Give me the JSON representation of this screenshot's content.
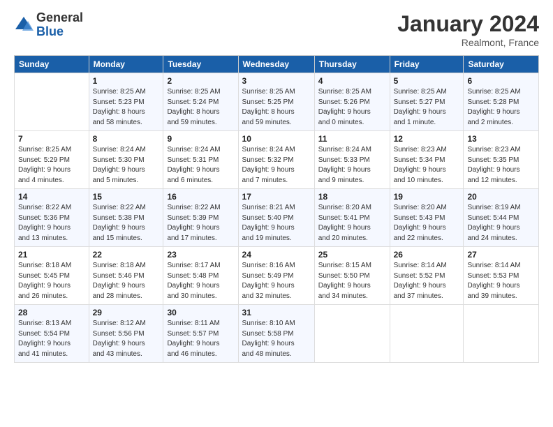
{
  "logo": {
    "general": "General",
    "blue": "Blue"
  },
  "title": "January 2024",
  "location": "Realmont, France",
  "days_header": [
    "Sunday",
    "Monday",
    "Tuesday",
    "Wednesday",
    "Thursday",
    "Friday",
    "Saturday"
  ],
  "weeks": [
    [
      {
        "num": "",
        "info": ""
      },
      {
        "num": "1",
        "info": "Sunrise: 8:25 AM\nSunset: 5:23 PM\nDaylight: 8 hours\nand 58 minutes."
      },
      {
        "num": "2",
        "info": "Sunrise: 8:25 AM\nSunset: 5:24 PM\nDaylight: 8 hours\nand 59 minutes."
      },
      {
        "num": "3",
        "info": "Sunrise: 8:25 AM\nSunset: 5:25 PM\nDaylight: 8 hours\nand 59 minutes."
      },
      {
        "num": "4",
        "info": "Sunrise: 8:25 AM\nSunset: 5:26 PM\nDaylight: 9 hours\nand 0 minutes."
      },
      {
        "num": "5",
        "info": "Sunrise: 8:25 AM\nSunset: 5:27 PM\nDaylight: 9 hours\nand 1 minute."
      },
      {
        "num": "6",
        "info": "Sunrise: 8:25 AM\nSunset: 5:28 PM\nDaylight: 9 hours\nand 2 minutes."
      }
    ],
    [
      {
        "num": "7",
        "info": "Sunrise: 8:25 AM\nSunset: 5:29 PM\nDaylight: 9 hours\nand 4 minutes."
      },
      {
        "num": "8",
        "info": "Sunrise: 8:24 AM\nSunset: 5:30 PM\nDaylight: 9 hours\nand 5 minutes."
      },
      {
        "num": "9",
        "info": "Sunrise: 8:24 AM\nSunset: 5:31 PM\nDaylight: 9 hours\nand 6 minutes."
      },
      {
        "num": "10",
        "info": "Sunrise: 8:24 AM\nSunset: 5:32 PM\nDaylight: 9 hours\nand 7 minutes."
      },
      {
        "num": "11",
        "info": "Sunrise: 8:24 AM\nSunset: 5:33 PM\nDaylight: 9 hours\nand 9 minutes."
      },
      {
        "num": "12",
        "info": "Sunrise: 8:23 AM\nSunset: 5:34 PM\nDaylight: 9 hours\nand 10 minutes."
      },
      {
        "num": "13",
        "info": "Sunrise: 8:23 AM\nSunset: 5:35 PM\nDaylight: 9 hours\nand 12 minutes."
      }
    ],
    [
      {
        "num": "14",
        "info": "Sunrise: 8:22 AM\nSunset: 5:36 PM\nDaylight: 9 hours\nand 13 minutes."
      },
      {
        "num": "15",
        "info": "Sunrise: 8:22 AM\nSunset: 5:38 PM\nDaylight: 9 hours\nand 15 minutes."
      },
      {
        "num": "16",
        "info": "Sunrise: 8:22 AM\nSunset: 5:39 PM\nDaylight: 9 hours\nand 17 minutes."
      },
      {
        "num": "17",
        "info": "Sunrise: 8:21 AM\nSunset: 5:40 PM\nDaylight: 9 hours\nand 19 minutes."
      },
      {
        "num": "18",
        "info": "Sunrise: 8:20 AM\nSunset: 5:41 PM\nDaylight: 9 hours\nand 20 minutes."
      },
      {
        "num": "19",
        "info": "Sunrise: 8:20 AM\nSunset: 5:43 PM\nDaylight: 9 hours\nand 22 minutes."
      },
      {
        "num": "20",
        "info": "Sunrise: 8:19 AM\nSunset: 5:44 PM\nDaylight: 9 hours\nand 24 minutes."
      }
    ],
    [
      {
        "num": "21",
        "info": "Sunrise: 8:18 AM\nSunset: 5:45 PM\nDaylight: 9 hours\nand 26 minutes."
      },
      {
        "num": "22",
        "info": "Sunrise: 8:18 AM\nSunset: 5:46 PM\nDaylight: 9 hours\nand 28 minutes."
      },
      {
        "num": "23",
        "info": "Sunrise: 8:17 AM\nSunset: 5:48 PM\nDaylight: 9 hours\nand 30 minutes."
      },
      {
        "num": "24",
        "info": "Sunrise: 8:16 AM\nSunset: 5:49 PM\nDaylight: 9 hours\nand 32 minutes."
      },
      {
        "num": "25",
        "info": "Sunrise: 8:15 AM\nSunset: 5:50 PM\nDaylight: 9 hours\nand 34 minutes."
      },
      {
        "num": "26",
        "info": "Sunrise: 8:14 AM\nSunset: 5:52 PM\nDaylight: 9 hours\nand 37 minutes."
      },
      {
        "num": "27",
        "info": "Sunrise: 8:14 AM\nSunset: 5:53 PM\nDaylight: 9 hours\nand 39 minutes."
      }
    ],
    [
      {
        "num": "28",
        "info": "Sunrise: 8:13 AM\nSunset: 5:54 PM\nDaylight: 9 hours\nand 41 minutes."
      },
      {
        "num": "29",
        "info": "Sunrise: 8:12 AM\nSunset: 5:56 PM\nDaylight: 9 hours\nand 43 minutes."
      },
      {
        "num": "30",
        "info": "Sunrise: 8:11 AM\nSunset: 5:57 PM\nDaylight: 9 hours\nand 46 minutes."
      },
      {
        "num": "31",
        "info": "Sunrise: 8:10 AM\nSunset: 5:58 PM\nDaylight: 9 hours\nand 48 minutes."
      },
      {
        "num": "",
        "info": ""
      },
      {
        "num": "",
        "info": ""
      },
      {
        "num": "",
        "info": ""
      }
    ]
  ]
}
